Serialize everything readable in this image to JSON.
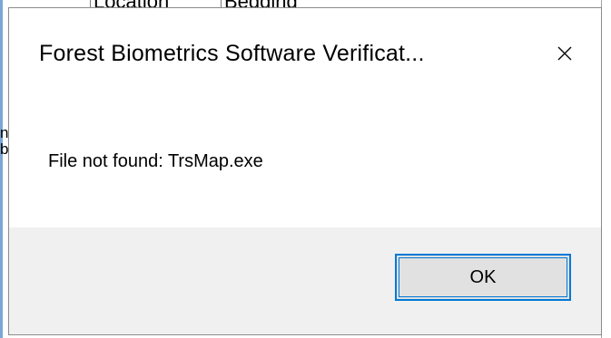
{
  "background_window": {
    "header_cells": [
      "Location",
      "Bedding"
    ],
    "left_fragments": [
      "n",
      "bl"
    ]
  },
  "dialog": {
    "title": "Forest Biometrics Software Verificat...",
    "close_icon": "close-icon",
    "message": "File not found: TrsMap.exe",
    "ok_label": "OK"
  },
  "colors": {
    "accent": "#0078d7",
    "footer_bg": "#f0f0f0",
    "button_bg": "#e1e1e1"
  }
}
